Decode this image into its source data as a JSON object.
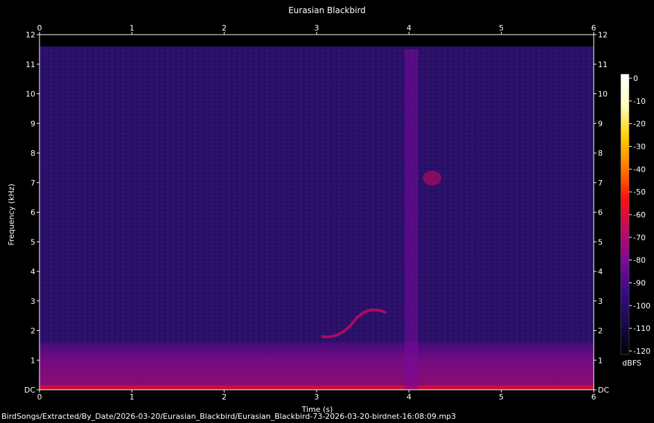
{
  "chart_data": {
    "type": "heatmap",
    "title": "Eurasian Blackbird",
    "xlabel": "Time (s)",
    "ylabel": "Frequency (kHz)",
    "xlim": [
      0,
      6
    ],
    "ylim": [
      0,
      12
    ],
    "x_ticks": [
      "0",
      "1",
      "2",
      "3",
      "4",
      "5",
      "6"
    ],
    "y_ticks": [
      "DC",
      "1",
      "2",
      "3",
      "4",
      "5",
      "6",
      "7",
      "8",
      "9",
      "10",
      "11",
      "12"
    ],
    "colorbar": {
      "label": "dBFS",
      "range": [
        -120,
        0
      ],
      "ticks": [
        "0",
        "-10",
        "-20",
        "-30",
        "-40",
        "-50",
        "-60",
        "-70",
        "-80",
        "-90",
        "-100",
        "-110",
        "-120"
      ],
      "colors": [
        "#000000",
        "#1a0a4a",
        "#3a0a8a",
        "#7a0a9a",
        "#c00a60",
        "#ff1010",
        "#ff7a00",
        "#ffd000",
        "#ffffc0",
        "#ffffff"
      ]
    },
    "features": [
      {
        "kind": "noise-floor",
        "t0": 0,
        "t1": 6,
        "f0": 0,
        "f1": 11.6,
        "level_db": -100
      },
      {
        "kind": "low-band",
        "t0": 0,
        "t1": 6,
        "f0": 0,
        "f1": 1.6,
        "level_db": -70
      },
      {
        "kind": "broadband-click",
        "t0": 3.95,
        "t1": 4.1,
        "f0": 0,
        "f1": 11.5,
        "level_db": -78
      },
      {
        "kind": "song-trace",
        "t0": 3.0,
        "t1": 3.75,
        "f0": 1.8,
        "f1": 2.6,
        "level_db": -65
      },
      {
        "kind": "blob",
        "t0": 4.15,
        "t1": 4.35,
        "f0": 6.9,
        "f1": 7.4,
        "level_db": -72
      }
    ]
  },
  "footer": {
    "file_path": "BirdSongs/Extracted/By_Date/2026-03-20/Eurasian_Blackbird/Eurasian_Blackbird-73-2026-03-20-birdnet-16:08:09.mp3"
  }
}
